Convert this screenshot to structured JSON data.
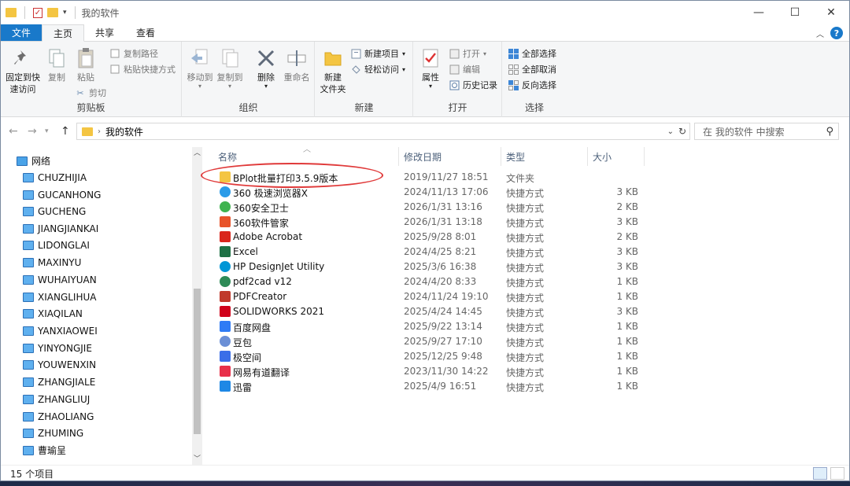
{
  "window": {
    "title": "我的软件"
  },
  "tabs": {
    "file": "文件",
    "home": "主页",
    "share": "共享",
    "view": "查看"
  },
  "ribbon": {
    "clipboard": {
      "label": "剪贴板",
      "pin": "固定到快\n速访问",
      "copy": "复制",
      "paste": "粘贴",
      "copy_path": "复制路径",
      "paste_shortcut": "粘贴快捷方式",
      "cut": "剪切"
    },
    "organize": {
      "label": "组织",
      "move_to": "移动到",
      "copy_to": "复制到",
      "delete": "删除",
      "rename": "重命名"
    },
    "new": {
      "label": "新建",
      "new_folder": "新建\n文件夹",
      "new_item": "新建项目",
      "easy_access": "轻松访问"
    },
    "open": {
      "label": "打开",
      "properties": "属性",
      "open": "打开",
      "edit": "编辑",
      "history": "历史记录"
    },
    "select": {
      "label": "选择",
      "select_all": "全部选择",
      "select_none": "全部取消",
      "invert": "反向选择"
    }
  },
  "address": {
    "path": "我的软件",
    "search_placeholder": "在 我的软件 中搜索"
  },
  "nav": {
    "root": "网络",
    "items": [
      "CHUZHIJIA",
      "GUCANHONG",
      "GUCHENG",
      "JIANGJIANKAI",
      "LIDONGLAI",
      "MAXINYU",
      "WUHAIYUAN",
      "XIANGLIHUA",
      "XIAQILAN",
      "YANXIAOWEI",
      "YINYONGJIE",
      "YOUWENXIN",
      "ZHANGJIALE",
      "ZHANGLIUJ",
      "ZHAOLIANG",
      "ZHUMING",
      "曹瑜呈"
    ]
  },
  "columns": {
    "name": "名称",
    "date": "修改日期",
    "type": "类型",
    "size": "大小"
  },
  "files": [
    {
      "name": "BPlot批量打印3.5.9版本",
      "date": "2019/11/27 18:51",
      "type": "文件夹",
      "size": "",
      "icon_color": "#f4c542"
    },
    {
      "name": "360 极速浏览器X",
      "date": "2024/11/13 17:06",
      "type": "快捷方式",
      "size": "3 KB",
      "icon_color": "#2a9be8"
    },
    {
      "name": "360安全卫士",
      "date": "2026/1/31 13:16",
      "type": "快捷方式",
      "size": "2 KB",
      "icon_color": "#3fb34f"
    },
    {
      "name": "360软件管家",
      "date": "2026/1/31 13:18",
      "type": "快捷方式",
      "size": "3 KB",
      "icon_color": "#e8542a"
    },
    {
      "name": "Adobe Acrobat",
      "date": "2025/9/28 8:01",
      "type": "快捷方式",
      "size": "2 KB",
      "icon_color": "#d9261c"
    },
    {
      "name": "Excel",
      "date": "2024/4/25 8:21",
      "type": "快捷方式",
      "size": "3 KB",
      "icon_color": "#1e7145"
    },
    {
      "name": "HP DesignJet Utility",
      "date": "2025/3/6 16:38",
      "type": "快捷方式",
      "size": "3 KB",
      "icon_color": "#0096d6"
    },
    {
      "name": "pdf2cad v12",
      "date": "2024/4/20 8:33",
      "type": "快捷方式",
      "size": "1 KB",
      "icon_color": "#2e8b57"
    },
    {
      "name": "PDFCreator",
      "date": "2024/11/24 19:10",
      "type": "快捷方式",
      "size": "1 KB",
      "icon_color": "#c0392b"
    },
    {
      "name": "SOLIDWORKS 2021",
      "date": "2025/4/24 14:45",
      "type": "快捷方式",
      "size": "3 KB",
      "icon_color": "#d0021b"
    },
    {
      "name": "百度网盘",
      "date": "2025/9/22 13:14",
      "type": "快捷方式",
      "size": "1 KB",
      "icon_color": "#2f7bf5"
    },
    {
      "name": "豆包",
      "date": "2025/9/27 17:10",
      "type": "快捷方式",
      "size": "1 KB",
      "icon_color": "#6b8fd6"
    },
    {
      "name": "极空间",
      "date": "2025/12/25 9:48",
      "type": "快捷方式",
      "size": "1 KB",
      "icon_color": "#3a6ee8"
    },
    {
      "name": "网易有道翻译",
      "date": "2023/11/30 14:22",
      "type": "快捷方式",
      "size": "1 KB",
      "icon_color": "#e8304a"
    },
    {
      "name": "迅雷",
      "date": "2025/4/9 16:51",
      "type": "快捷方式",
      "size": "1 KB",
      "icon_color": "#1e88e5"
    }
  ],
  "status": {
    "count": "15 个项目"
  }
}
